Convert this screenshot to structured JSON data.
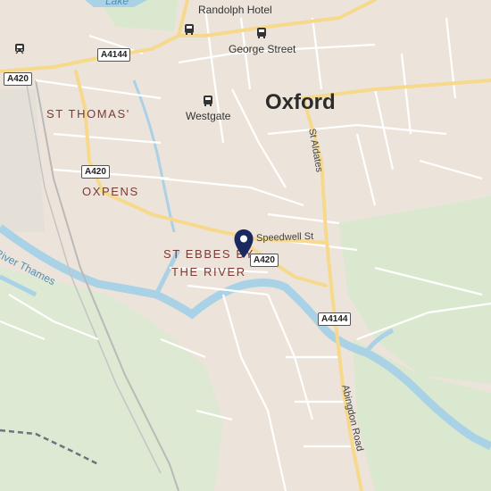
{
  "map": {
    "place_labels": {
      "city": "Oxford",
      "st_thomas": "ST THOMAS'",
      "oxpens": "OXPENS",
      "st_ebbes_1": "ST EBBES BY",
      "st_ebbes_2": "THE RIVER"
    },
    "poi_labels": {
      "randolph": "Randolph Hotel",
      "george_street": "George Street",
      "westgate": "Westgate"
    },
    "street_labels": {
      "st_aldates": "St Aldates",
      "speedwell": "Speedwell St",
      "abingdon": "Abingdon Road"
    },
    "water_labels": {
      "lake": "Lake",
      "thames": "River Thames"
    },
    "road_shields": {
      "a4144_north": "A4144",
      "a420_west": "A420",
      "a420_oxpens": "A420",
      "a420_speedwell": "A420",
      "a4144_south": "A4144"
    },
    "marker": {
      "icon": "location-pin-icon",
      "color": "#1a2a5e"
    },
    "colors": {
      "land": "#efe9e1",
      "urban": "#ece3d8",
      "park": "#d9e8cf",
      "water": "#a9d2e6",
      "major_road": "#f9d98a",
      "minor_road": "#ffffff",
      "rail": "#b9b9b9",
      "boundary": "#6d7280"
    }
  }
}
